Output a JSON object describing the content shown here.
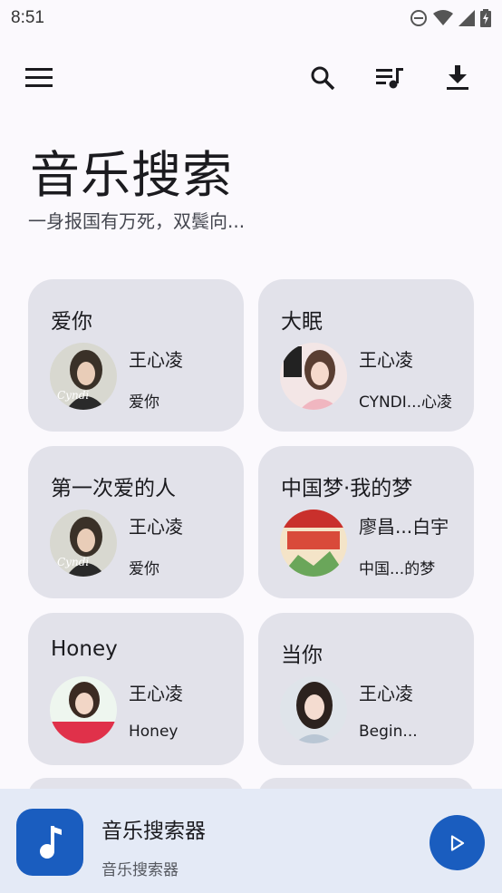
{
  "status_bar": {
    "time": "8:51"
  },
  "header": {
    "title": "音乐搜索",
    "subtitle": "一身报国有万死，双鬓向..."
  },
  "icons": {
    "menu": "menu-icon",
    "search": "search-icon",
    "queue": "queue-music-icon",
    "download": "download-icon"
  },
  "songs": [
    {
      "title": "爱你",
      "artist": "王心凌",
      "album": "爱你"
    },
    {
      "title": "大眠",
      "artist": "王心凌",
      "album": "CYNDI...心凌"
    },
    {
      "title": "第一次爱的人",
      "artist": "王心凌",
      "album": "爱你"
    },
    {
      "title": "中国梦·我的梦",
      "artist": "廖昌...白宇",
      "album": "中国...的梦"
    },
    {
      "title": "Honey",
      "artist": "王心凌",
      "album": "Honey"
    },
    {
      "title": "当你",
      "artist": "王心凌",
      "album": "Begin..."
    }
  ],
  "player": {
    "title": "音乐搜索器",
    "subtitle": "音乐搜索器"
  },
  "colors": {
    "accent": "#1a5dbf",
    "card_bg": "#e2e2ea",
    "player_bg": "#e4eaf6"
  }
}
